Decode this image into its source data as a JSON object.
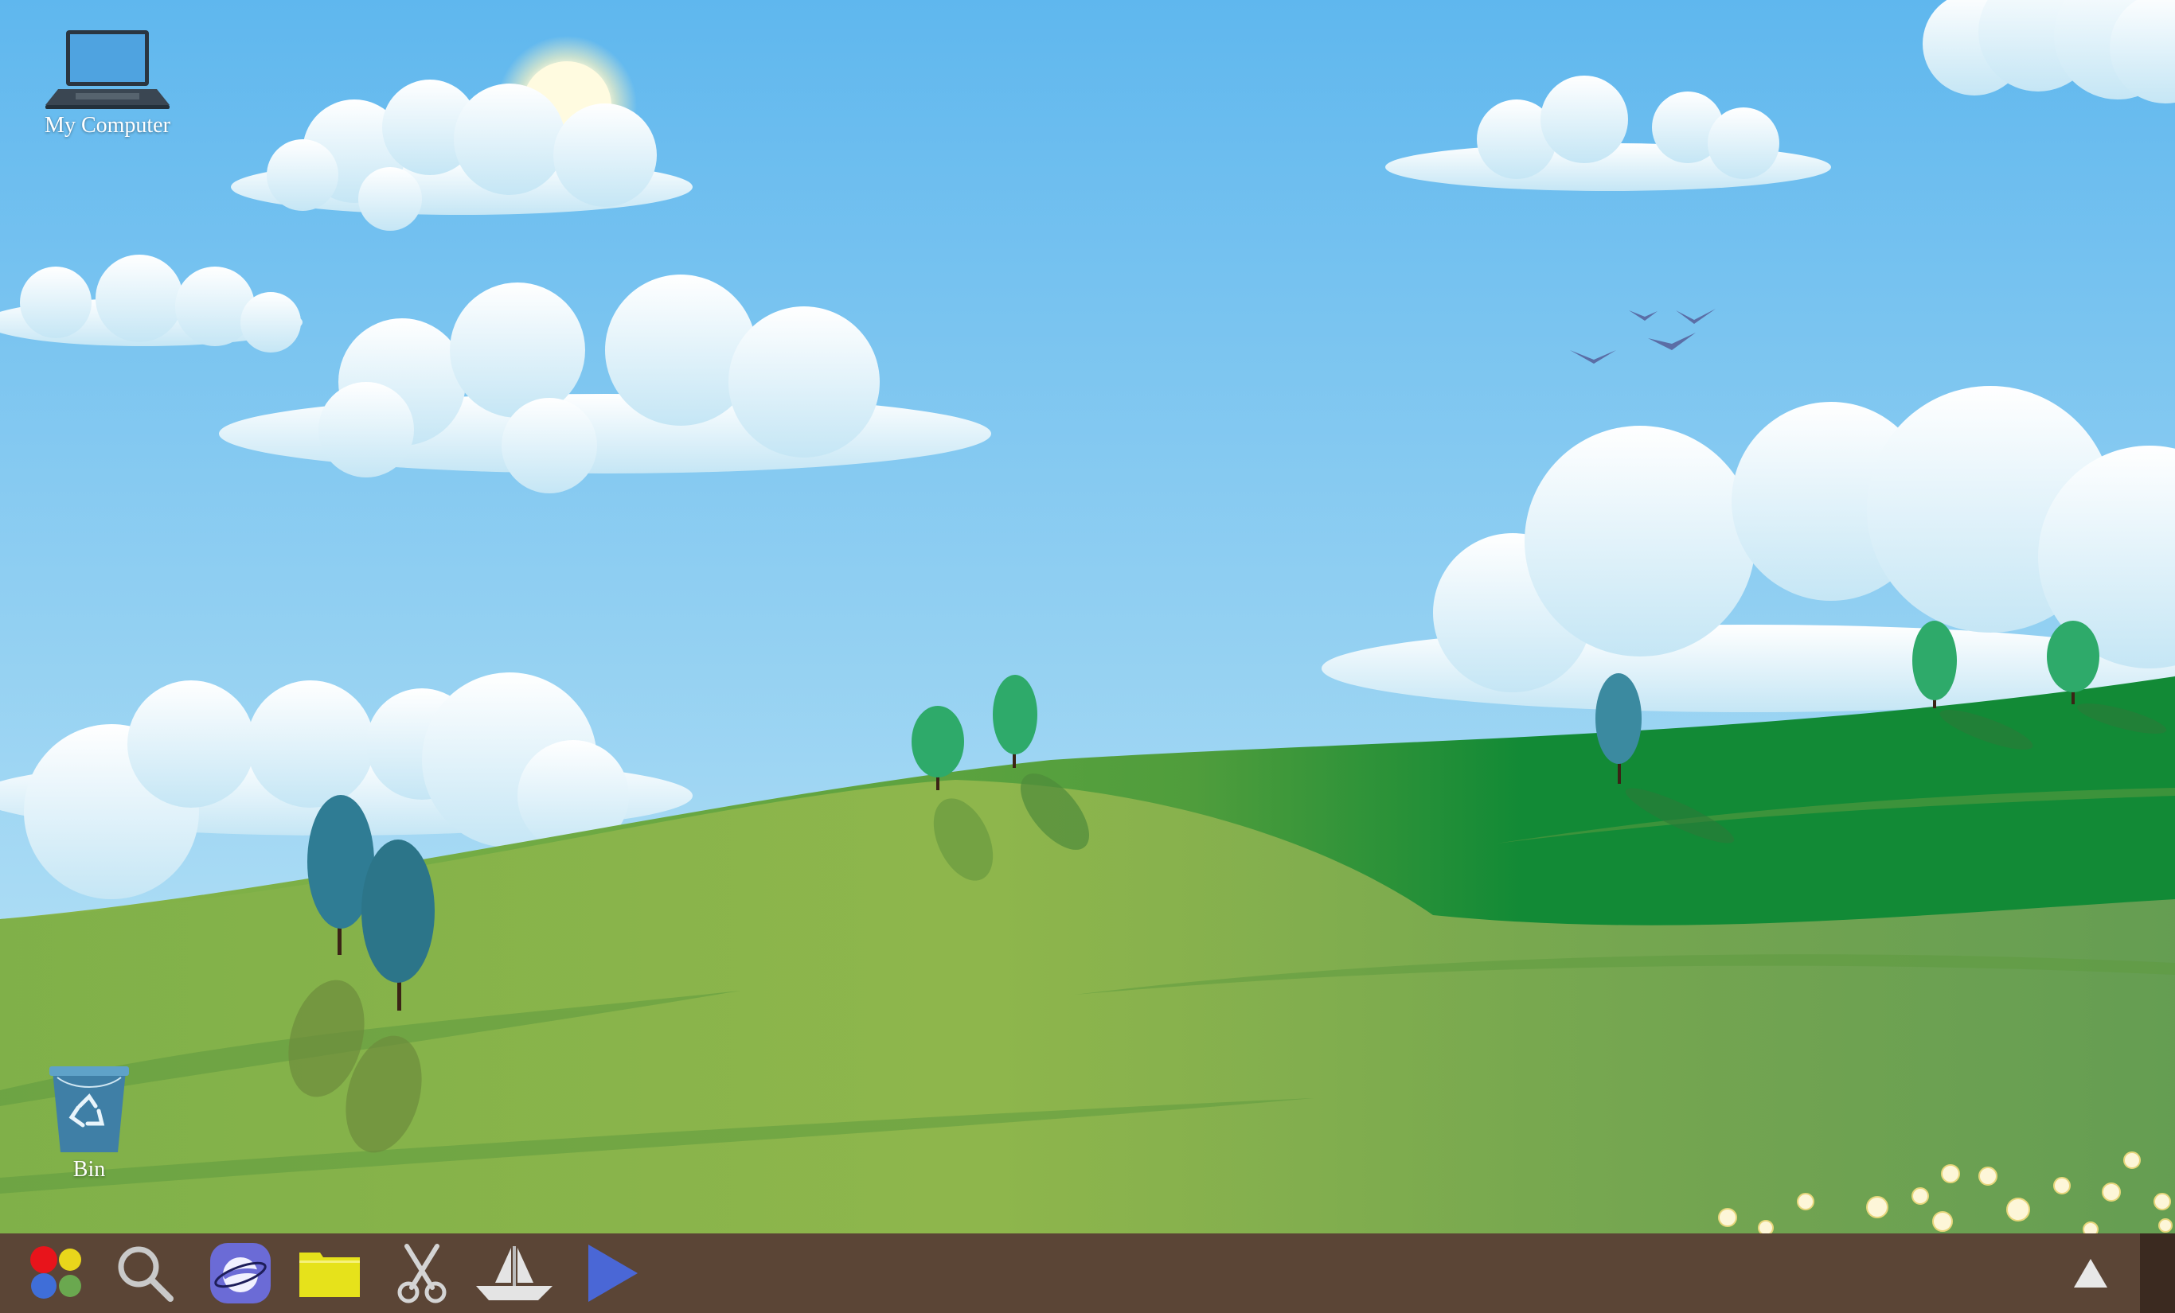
{
  "desktop": {
    "icons": [
      {
        "id": "my-computer",
        "label": "My Computer",
        "icon": "laptop-icon"
      },
      {
        "id": "bin",
        "label": "Bin",
        "icon": "recycle-bin-icon"
      }
    ],
    "wallpaper": {
      "scene": "hills-and-sky",
      "colors": {
        "sky_top": "#5fb7ee",
        "sky_bottom": "#bfe6f6",
        "hill_light": "#8fb84a",
        "hill_dark": "#178a34",
        "sun": "#fffbe0"
      }
    }
  },
  "taskbar": {
    "background": "#5b4536",
    "items": [
      {
        "id": "app-menu",
        "icon": "app-menu-dots-icon",
        "colors": [
          "#e8141b",
          "#e9d61b",
          "#3f6ed8",
          "#6aa84f"
        ]
      },
      {
        "id": "search",
        "icon": "search-icon"
      },
      {
        "id": "browser",
        "icon": "planet-browser-icon",
        "color": "#6b6bd6"
      },
      {
        "id": "files",
        "icon": "folder-icon",
        "color": "#e6e21b"
      },
      {
        "id": "screenshot",
        "icon": "scissors-icon"
      },
      {
        "id": "sailboat",
        "icon": "sailboat-icon"
      },
      {
        "id": "media-player",
        "icon": "play-icon",
        "color": "#4a67d6"
      }
    ],
    "tray": {
      "icon": "triangle-up-icon"
    }
  }
}
